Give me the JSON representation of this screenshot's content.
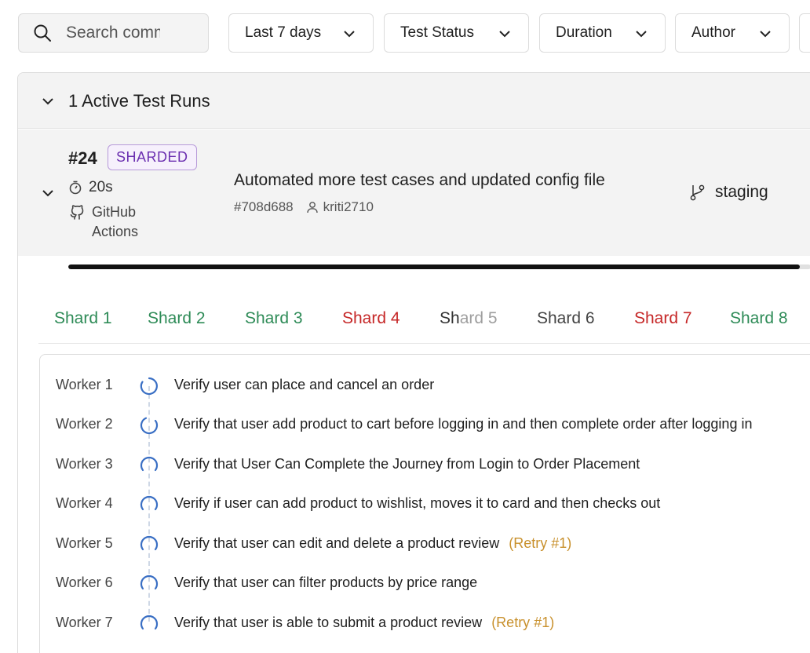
{
  "filters": {
    "search_placeholder": "Search commits",
    "search_value": "",
    "date_range": "Last 7 days",
    "status": "Test Status",
    "duration": "Duration",
    "author": "Author"
  },
  "section": {
    "title": "1 Active Test Runs"
  },
  "run": {
    "number": "#24",
    "badge": "SHARDED",
    "duration": "20s",
    "ci_provider": "GitHub Actions",
    "commit_title": "Automated more test cases and updated config file",
    "commit_hash": "#708d688",
    "author": "kriti2710",
    "branch": "staging",
    "progress": 0.985
  },
  "shards": [
    {
      "label": "Shard 1",
      "status": "passed"
    },
    {
      "label": "Shard 2",
      "status": "passed"
    },
    {
      "label": "Shard 3",
      "status": "passed"
    },
    {
      "label": "Shard 4",
      "status": "failed"
    },
    {
      "label": "Shard 5",
      "status": "running"
    },
    {
      "label": "Shard 6",
      "status": "pending"
    },
    {
      "label": "Shard 7",
      "status": "failed"
    },
    {
      "label": "Shard 8",
      "status": "passed"
    }
  ],
  "workers": [
    {
      "name": "Worker 1",
      "test": "Verify user can place and cancel an order",
      "retry": ""
    },
    {
      "name": "Worker 2",
      "test": "Verify that user add product to cart before logging in and then complete order after logging in",
      "retry": ""
    },
    {
      "name": "Worker 3",
      "test": "Verify that User Can Complete the Journey from Login to Order Placement",
      "retry": ""
    },
    {
      "name": "Worker 4",
      "test": "Verify if user can add product to wishlist, moves it to card and then checks out",
      "retry": ""
    },
    {
      "name": "Worker 5",
      "test": "Verify that user can edit and delete a product review",
      "retry": "(Retry #1)"
    },
    {
      "name": "Worker 6",
      "test": "Verify that user can filter products by price range",
      "retry": ""
    },
    {
      "name": "Worker 7",
      "test": "Verify that user is able to submit a product review",
      "retry": "(Retry #1)"
    }
  ],
  "colors": {
    "passed": "#2e8b57",
    "failed": "#c62828",
    "retry": "#c8902c",
    "badge": "#6b2fb0",
    "spinner": "#3a6fc4"
  }
}
